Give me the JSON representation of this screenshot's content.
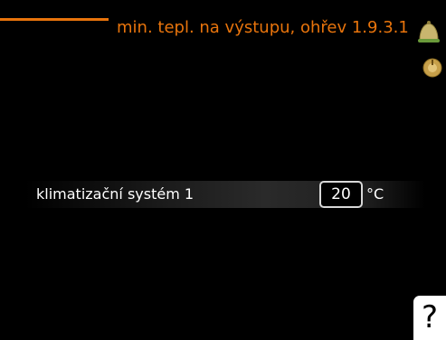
{
  "header": {
    "title": "min. tepl. na výstupu, ohřev 1.9.3.1"
  },
  "icons": {
    "top_right": "bell-icon",
    "secondary": "dial-icon"
  },
  "setting": {
    "label": "klimatizační systém 1",
    "value": "20",
    "unit": "°C"
  },
  "help": {
    "label": "?"
  },
  "colors": {
    "accent": "#e8740c",
    "background": "#000000",
    "text": "#ffffff"
  }
}
